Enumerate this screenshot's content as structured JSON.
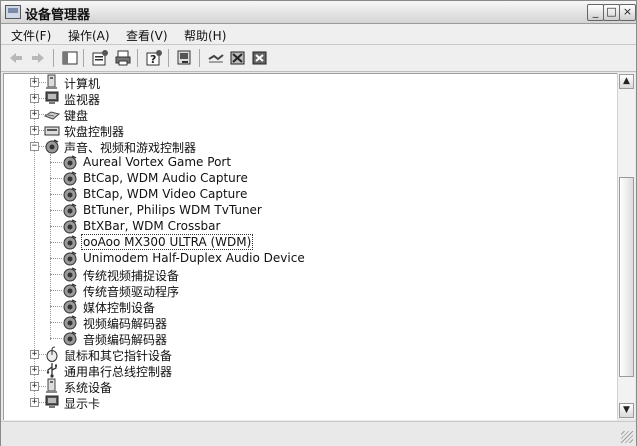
{
  "window": {
    "title": "设备管理器",
    "controls": {
      "minimize": "_",
      "maximize": "□",
      "close": "×"
    }
  },
  "menu": [
    "文件(F)",
    "操作(A)",
    "查看(V)",
    "帮助(H)"
  ],
  "toolbar": {
    "icons": [
      "back-arrow-icon",
      "forward-arrow-icon",
      "show-hide-tree-icon",
      "properties-icon",
      "print-icon",
      "help-icon",
      "scan-hardware-icon",
      "update-driver-icon",
      "disable-device-icon",
      "uninstall-device-icon"
    ]
  },
  "tree": {
    "top_nodes": [
      {
        "label": "计算机",
        "icon": "computer-icon",
        "expanded": false
      },
      {
        "label": "监视器",
        "icon": "monitor-icon",
        "expanded": false
      },
      {
        "label": "键盘",
        "icon": "keyboard-icon",
        "expanded": false
      },
      {
        "label": "软盘控制器",
        "icon": "floppy-controller-icon",
        "expanded": false
      },
      {
        "label": "声音、视频和游戏控制器",
        "icon": "sound-device-icon",
        "expanded": true
      }
    ],
    "sound_children": [
      "Aureal Vortex Game Port",
      "BtCap, WDM Audio Capture",
      "BtCap, WDM Video Capture",
      "BtTuner, Philips WDM TvTuner",
      "BtXBar, WDM Crossbar",
      "ooAoo MX300 ULTRA (WDM)",
      "Unimodem Half-Duplex Audio Device",
      "传统视频捕捉设备",
      "传统音频驱动程序",
      "媒体控制设备",
      "视频编码解码器",
      "音频编码解码器"
    ],
    "selected_child": "ooAoo MX300 ULTRA (WDM)",
    "bottom_nodes": [
      {
        "label": "鼠标和其它指针设备",
        "icon": "mouse-icon",
        "expanded": false
      },
      {
        "label": "通用串行总线控制器",
        "icon": "usb-icon",
        "expanded": false
      },
      {
        "label": "系统设备",
        "icon": "system-device-icon",
        "expanded": false
      },
      {
        "label": "显示卡",
        "icon": "display-adapter-icon",
        "expanded": false
      }
    ],
    "expander_collapsed": "+",
    "expander_expanded": "−"
  },
  "scrollbar": {
    "up": "▲",
    "down": "▼"
  }
}
